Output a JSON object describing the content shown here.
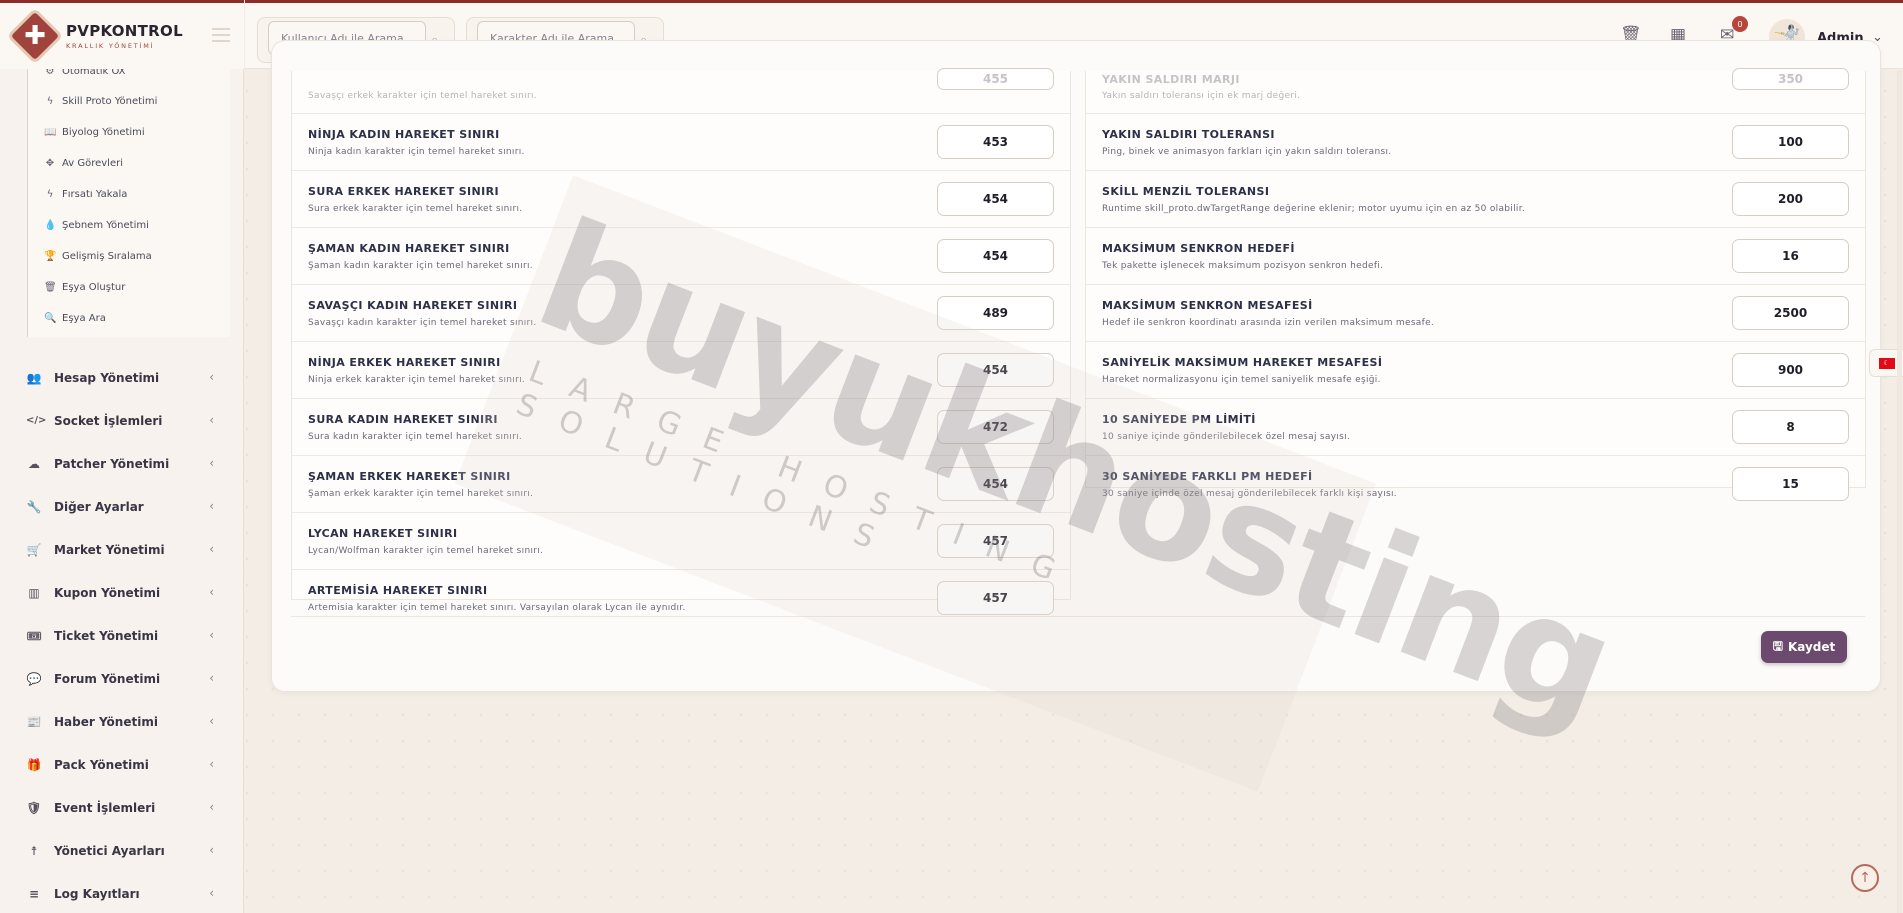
{
  "brand": {
    "title": "PVPKONTROL",
    "subtitle": "KRALLIK YÖNETİMİ"
  },
  "header": {
    "search_user_placeholder": "Kullanıcı Adı ile Arama",
    "search_char_placeholder": "Karakter Adı ile Arama",
    "notification_count": "0",
    "user_name": "Admin"
  },
  "sidebar": {
    "sub_items": [
      {
        "icon": "⚙",
        "label": "Otomatik OX"
      },
      {
        "icon": "ϟ",
        "label": "Skill Proto Yönetimi"
      },
      {
        "icon": "📖",
        "label": "Biyolog Yönetimi"
      },
      {
        "icon": "✥",
        "label": "Av Görevleri"
      },
      {
        "icon": "ϟ",
        "label": "Fırsatı Yakala"
      },
      {
        "icon": "💧",
        "label": "Şebnem Yönetimi"
      },
      {
        "icon": "🏆",
        "label": "Gelişmiş Sıralama"
      },
      {
        "icon": "🗑",
        "label": "Eşya Oluştur"
      },
      {
        "icon": "🔍",
        "label": "Eşya Ara"
      }
    ],
    "menu_items": [
      {
        "icon": "👥",
        "label": "Hesap Yönetimi"
      },
      {
        "icon": "</>",
        "label": "Socket İşlemleri"
      },
      {
        "icon": "☁",
        "label": "Patcher Yönetimi"
      },
      {
        "icon": "🔧",
        "label": "Diğer Ayarlar"
      },
      {
        "icon": "🛒",
        "label": "Market Yönetimi"
      },
      {
        "icon": "▥",
        "label": "Kupon Yönetimi"
      },
      {
        "icon": "🎟",
        "label": "Ticket Yönetimi"
      },
      {
        "icon": "💬",
        "label": "Forum Yönetimi"
      },
      {
        "icon": "📰",
        "label": "Haber Yönetimi"
      },
      {
        "icon": "🎁",
        "label": "Pack Yönetimi"
      },
      {
        "icon": "🛡",
        "label": "Event İşlemleri"
      },
      {
        "icon": "☨",
        "label": "Yönetici Ayarları"
      },
      {
        "icon": "≡",
        "label": "Log Kayıtları"
      }
    ]
  },
  "settings_left": [
    {
      "name": "",
      "desc": "Savaşçı erkek karakter için temel hareket sınırı.",
      "value": "455"
    },
    {
      "name": "NİNJA KADIN HAREKET SINIRI",
      "desc": "Ninja kadın karakter için temel hareket sınırı.",
      "value": "453"
    },
    {
      "name": "SURA ERKEK HAREKET SINIRI",
      "desc": "Sura erkek karakter için temel hareket sınırı.",
      "value": "454"
    },
    {
      "name": "ŞAMAN KADIN HAREKET SINIRI",
      "desc": "Şaman kadın karakter için temel hareket sınırı.",
      "value": "454"
    },
    {
      "name": "SAVAŞÇI KADIN HAREKET SINIRI",
      "desc": "Savaşçı kadın karakter için temel hareket sınırı.",
      "value": "489"
    },
    {
      "name": "NİNJA ERKEK HAREKET SINIRI",
      "desc": "Ninja erkek karakter için temel hareket sınırı.",
      "value": "454"
    },
    {
      "name": "SURA KADIN HAREKET SINIRI",
      "desc": "Sura kadın karakter için temel hareket sınırı.",
      "value": "472"
    },
    {
      "name": "ŞAMAN ERKEK HAREKET SINIRI",
      "desc": "Şaman erkek karakter için temel hareket sınırı.",
      "value": "454"
    },
    {
      "name": "LYCAN HAREKET SINIRI",
      "desc": "Lycan/Wolfman karakter için temel hareket sınırı.",
      "value": "457"
    },
    {
      "name": "ARTEMİSİA HAREKET SINIRI",
      "desc": "Artemisia karakter için temel hareket sınırı. Varsayılan olarak Lycan ile aynıdır.",
      "value": "457"
    }
  ],
  "settings_right": [
    {
      "name": "YAKIN SALDIRI MARJI",
      "desc": "Yakın saldırı toleransı için ek marj değeri.",
      "value": "350"
    },
    {
      "name": "YAKIN SALDIRI TOLERANSI",
      "desc": "Ping, binek ve animasyon farkları için yakın saldırı toleransı.",
      "value": "100"
    },
    {
      "name": "SKİLL MENZİL TOLERANSI",
      "desc": "Runtime skill_proto.dwTargetRange değerine eklenir; motor uyumu için en az 50 olabilir.",
      "value": "200"
    },
    {
      "name": "MAKSİMUM SENKRON HEDEFİ",
      "desc": "Tek pakette işlenecek maksimum pozisyon senkron hedefi.",
      "value": "16"
    },
    {
      "name": "MAKSİMUM SENKRON MESAFESİ",
      "desc": "Hedef ile senkron koordinatı arasında izin verilen maksimum mesafe.",
      "value": "2500"
    },
    {
      "name": "SANİYELİK MAKSİMUM HAREKET MESAFESİ",
      "desc": "Hareket normalizasyonu için temel saniyelik mesafe eşiği.",
      "value": "900"
    },
    {
      "name": "10 SANİYEDE PM LİMİTİ",
      "desc": "10 saniye içinde gönderilebilecek özel mesaj sayısı.",
      "value": "8"
    },
    {
      "name": "30 SANİYEDE FARKLI PM HEDEFİ",
      "desc": "30 saniye içinde özel mesaj gönderilebilecek farklı kişi sayısı.",
      "value": "15"
    }
  ],
  "save_label": "Kaydet",
  "watermark": {
    "main": "buyukhosting",
    "sub": "LARGE HOSTING SOLUTIONS"
  }
}
